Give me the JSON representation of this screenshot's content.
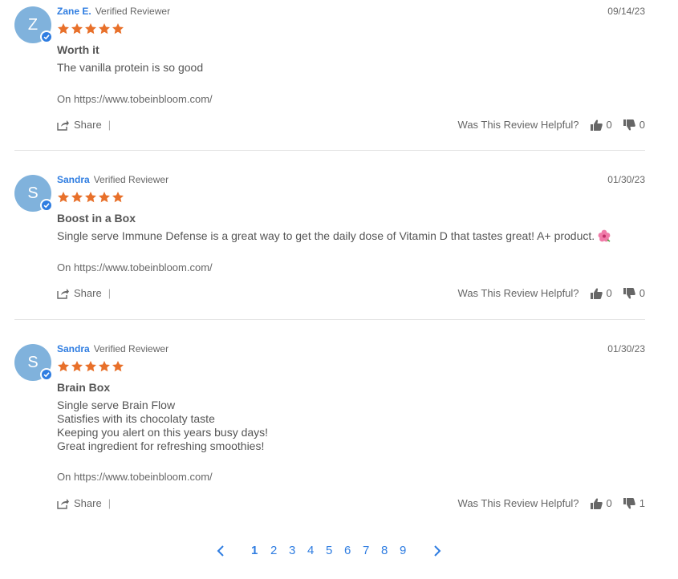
{
  "reviews": [
    {
      "initial": "Z",
      "name": "Zane E.",
      "badge": "Verified Reviewer",
      "date": "09/14/23",
      "rating": 5,
      "title": "Worth it",
      "body": [
        "The vanilla protein is so good"
      ],
      "source": "On https://www.tobeinbloom.com/",
      "share_label": "Share",
      "helpful_label": "Was This Review Helpful?",
      "up": "0",
      "down": "0"
    },
    {
      "initial": "S",
      "name": "Sandra",
      "badge": "Verified Reviewer",
      "date": "01/30/23",
      "rating": 5,
      "title": "Boost in a Box",
      "body": [
        "Single serve Immune Defense is a great way to get the daily dose of Vitamin D that tastes great! A+ product."
      ],
      "source": "On https://www.tobeinbloom.com/",
      "share_label": "Share",
      "helpful_label": "Was This Review Helpful?",
      "up": "0",
      "down": "0"
    },
    {
      "initial": "S",
      "name": "Sandra",
      "badge": "Verified Reviewer",
      "date": "01/30/23",
      "rating": 5,
      "title": "Brain Box",
      "body": [
        "Single serve Brain Flow",
        "Satisfies with its chocolaty taste",
        "Keeping you alert on this years busy days!",
        "Great ingredient for refreshing smoothies!"
      ],
      "source": "On https://www.tobeinbloom.com/",
      "share_label": "Share",
      "helpful_label": "Was This Review Helpful?",
      "up": "0",
      "down": "1"
    }
  ],
  "pagination": {
    "pages": [
      "1",
      "2",
      "3",
      "4",
      "5",
      "6",
      "7",
      "8",
      "9"
    ],
    "current": "1"
  },
  "colors": {
    "accent": "#2f7de1",
    "star": "#e8702a",
    "avatar": "#80b2dc"
  },
  "icons": {
    "prev": "chevron-left-icon",
    "next": "chevron-right-icon",
    "share": "share-icon",
    "up": "thumbs-up-icon",
    "down": "thumbs-down-icon",
    "verified": "check-badge-icon",
    "emoji": "hibiscus-emoji"
  }
}
